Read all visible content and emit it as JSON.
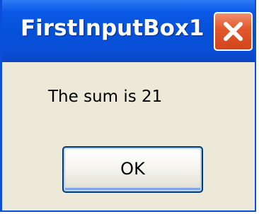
{
  "window": {
    "title": "FirstInputBox1",
    "close_icon": "close-x-icon"
  },
  "dialog": {
    "message": "The sum is 21",
    "ok_label": "OK"
  },
  "colors": {
    "titlebar": "#0a4fd8",
    "close_button": "#e3592e",
    "dialog_background": "#ece9d8"
  }
}
